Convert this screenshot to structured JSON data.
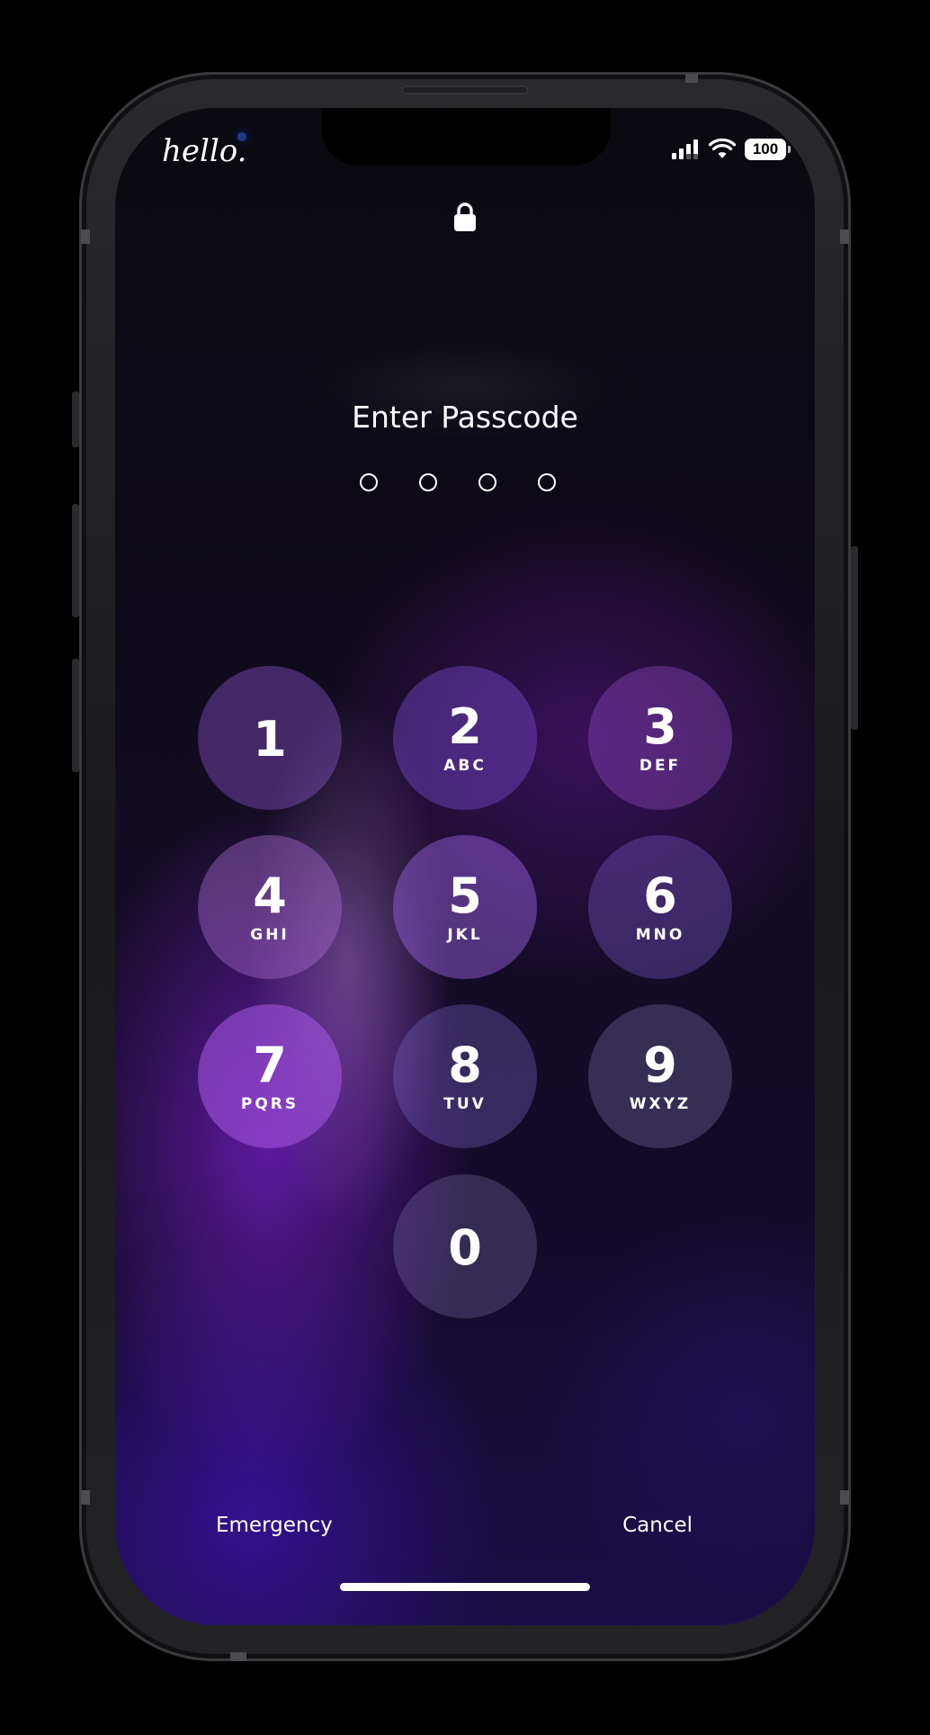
{
  "status_bar": {
    "logo": "hello.",
    "battery": "100"
  },
  "lock_screen": {
    "title": "Enter Passcode",
    "passcode_length": 4,
    "keys": [
      {
        "number": "1",
        "letters": ""
      },
      {
        "number": "2",
        "letters": "ABC"
      },
      {
        "number": "3",
        "letters": "DEF"
      },
      {
        "number": "4",
        "letters": "GHI"
      },
      {
        "number": "5",
        "letters": "JKL"
      },
      {
        "number": "6",
        "letters": "MNO"
      },
      {
        "number": "7",
        "letters": "PQRS"
      },
      {
        "number": "8",
        "letters": "TUV"
      },
      {
        "number": "9",
        "letters": "WXYZ"
      },
      {
        "number": "0",
        "letters": ""
      }
    ],
    "emergency_label": "Emergency",
    "cancel_label": "Cancel"
  },
  "icons": {
    "lock": "lock-icon",
    "signal": "cellular-signal-icon",
    "wifi": "wifi-icon",
    "battery": "battery-icon"
  }
}
